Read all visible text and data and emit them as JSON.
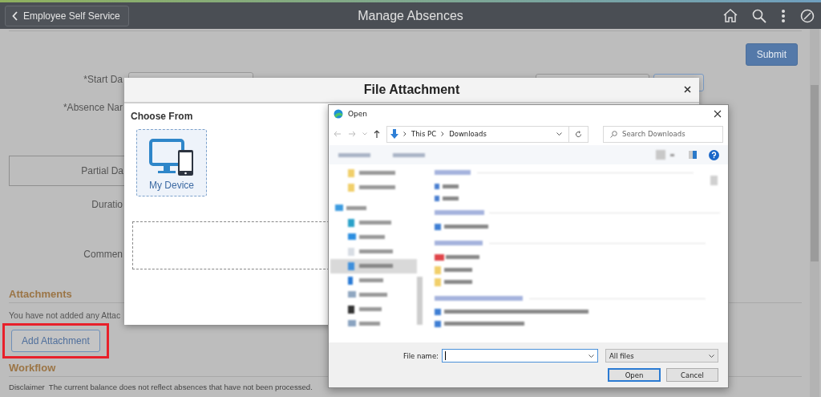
{
  "header": {
    "back_button": "Employee Self Service",
    "title": "Manage Absences"
  },
  "submit_button": "Submit",
  "form": {
    "labels": [
      {
        "text": "*Start Da",
        "kind": "plain"
      },
      {
        "text": "*Absence Nar",
        "kind": "plain"
      },
      {
        "text": "Partial Da",
        "kind": "boxed"
      },
      {
        "text": "Duratio",
        "kind": "plain"
      },
      {
        "text": "Commen",
        "kind": "tall"
      }
    ]
  },
  "attachments": {
    "heading": "Attachments",
    "message": "You have not added any Attac",
    "add_button": "Add Attachment",
    "highlighted": true
  },
  "workflow": {
    "heading": "Workflow",
    "disclaimer_label": "Disclaimer",
    "disclaimer": "The current balance does not reflect absences that have not been processed."
  },
  "file_attachment_modal": {
    "title": "File Attachment",
    "section_label": "Choose From",
    "sources": [
      {
        "label": "My Device",
        "selected": true
      }
    ]
  },
  "open_dialog": {
    "title": "Open",
    "breadcrumb": [
      "This PC",
      "Downloads"
    ],
    "search_placeholder": "Search Downloads",
    "file_name_label": "File name:",
    "file_type": "All files",
    "buttons": [
      {
        "label": "Open",
        "kind": "primary"
      },
      {
        "label": "Cancel",
        "kind": "secondary"
      }
    ]
  }
}
